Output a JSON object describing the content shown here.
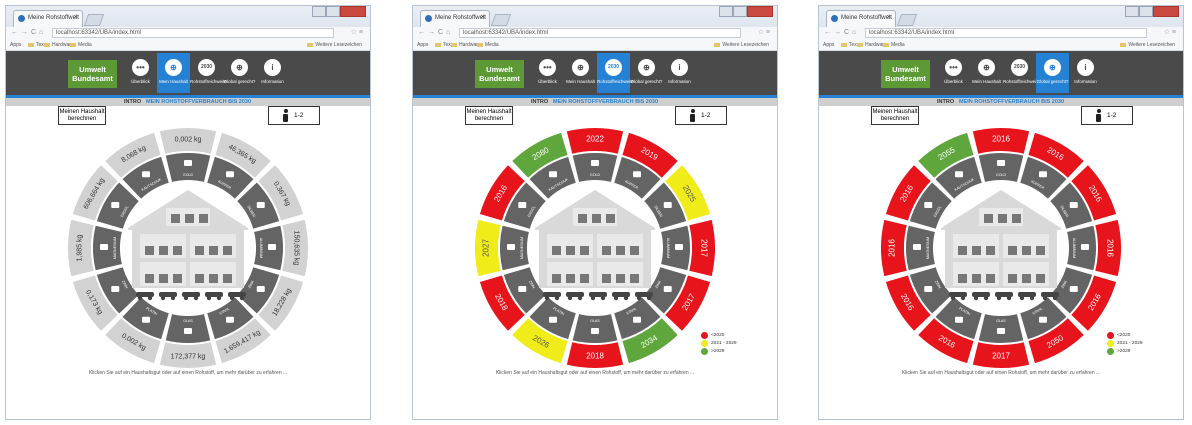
{
  "browser": {
    "tab_title": "Meine Rohstoffwelt",
    "tab_close": "×",
    "url": "localhost:63342/UBA/index.html",
    "bookmarks": [
      "Apps",
      "Tex",
      "Hardware",
      "Media"
    ],
    "bookmarks_other": "Weitere Lesezeichen"
  },
  "header": {
    "logo_line1": "Umwelt",
    "logo_line2": "Bundesamt",
    "nav": [
      {
        "label": "Überblick",
        "icon": "dots-icon",
        "glyph": "•••"
      },
      {
        "label": "Mein Haushalt",
        "icon": "globe-icon",
        "glyph": "⊕"
      },
      {
        "label": "Rohstoffreichweite",
        "icon": "year-icon",
        "glyph": "2030"
      },
      {
        "label": "Global gerecht?",
        "icon": "globe-icon",
        "glyph": "⊕"
      },
      {
        "label": "Information",
        "icon": "info-icon",
        "glyph": "i"
      }
    ]
  },
  "subnav": {
    "intro": "INTRO",
    "breadcrumb": "MEIN ROHSTOFFVERBRAUCH BIS 2030"
  },
  "controls": {
    "calc_line1": "Meinen Haushalt",
    "calc_line2": "berechnen",
    "people_value": "1-2"
  },
  "materials": [
    "GOLD",
    "KUPFER",
    "SILBER",
    "ALUMINIUM",
    "ZINK",
    "STAHL",
    "GLAS",
    "PLATIN",
    "ZINN",
    "MAGNESIUM",
    "ERDÖL",
    "KAUTSCHUK"
  ],
  "colors": {
    "red": "#e8141c",
    "yellow": "#f0ec1a",
    "green": "#5fa63c",
    "grey_outer": "#d2d2d2",
    "grey_inner": "#646464",
    "blue": "#2581d3",
    "header": "#4a4a4a"
  },
  "panels": [
    {
      "active_nav": 1,
      "mode": "kg",
      "outer": [
        "0,002 kg",
        "46,365 kg",
        "0,367 kg",
        "150,635 kg",
        "18,228 kg",
        "1.659,417 kg",
        "172,377 kg",
        "0,002 kg",
        "0,173 kg",
        "1,985 kg",
        "606,664 kg",
        "8,068 kg"
      ],
      "colors": [
        "grey",
        "grey",
        "grey",
        "grey",
        "grey",
        "grey",
        "grey",
        "grey",
        "grey",
        "grey",
        "grey",
        "grey"
      ]
    },
    {
      "active_nav": 2,
      "mode": "year",
      "outer": [
        "2022",
        "2019",
        "2025",
        "2017",
        "2017",
        "2034",
        "2018",
        "2026",
        "2018",
        "2027",
        "2016",
        "2080"
      ],
      "colors": [
        "red",
        "red",
        "yellow",
        "red",
        "red",
        "green",
        "red",
        "yellow",
        "red",
        "yellow",
        "red",
        "green"
      ]
    },
    {
      "active_nav": 3,
      "mode": "year",
      "outer": [
        "2016",
        "2016",
        "2016",
        "2016",
        "2016",
        "2050",
        "2017",
        "2016",
        "2016",
        "2016",
        "2016",
        "2055"
      ],
      "colors": [
        "red",
        "red",
        "red",
        "red",
        "red",
        "red",
        "red",
        "red",
        "red",
        "red",
        "red",
        "green"
      ]
    }
  ],
  "legend": [
    {
      "label": "<2020",
      "color": "red"
    },
    {
      "label": "2021 - 2029",
      "color": "yellow"
    },
    {
      "label": ">2029",
      "color": "green"
    }
  ],
  "hint": "Klicken Sie auf ein Haushaltsgut oder auf einen Rohstoff, um mehr darüber zu erfahren ..."
}
